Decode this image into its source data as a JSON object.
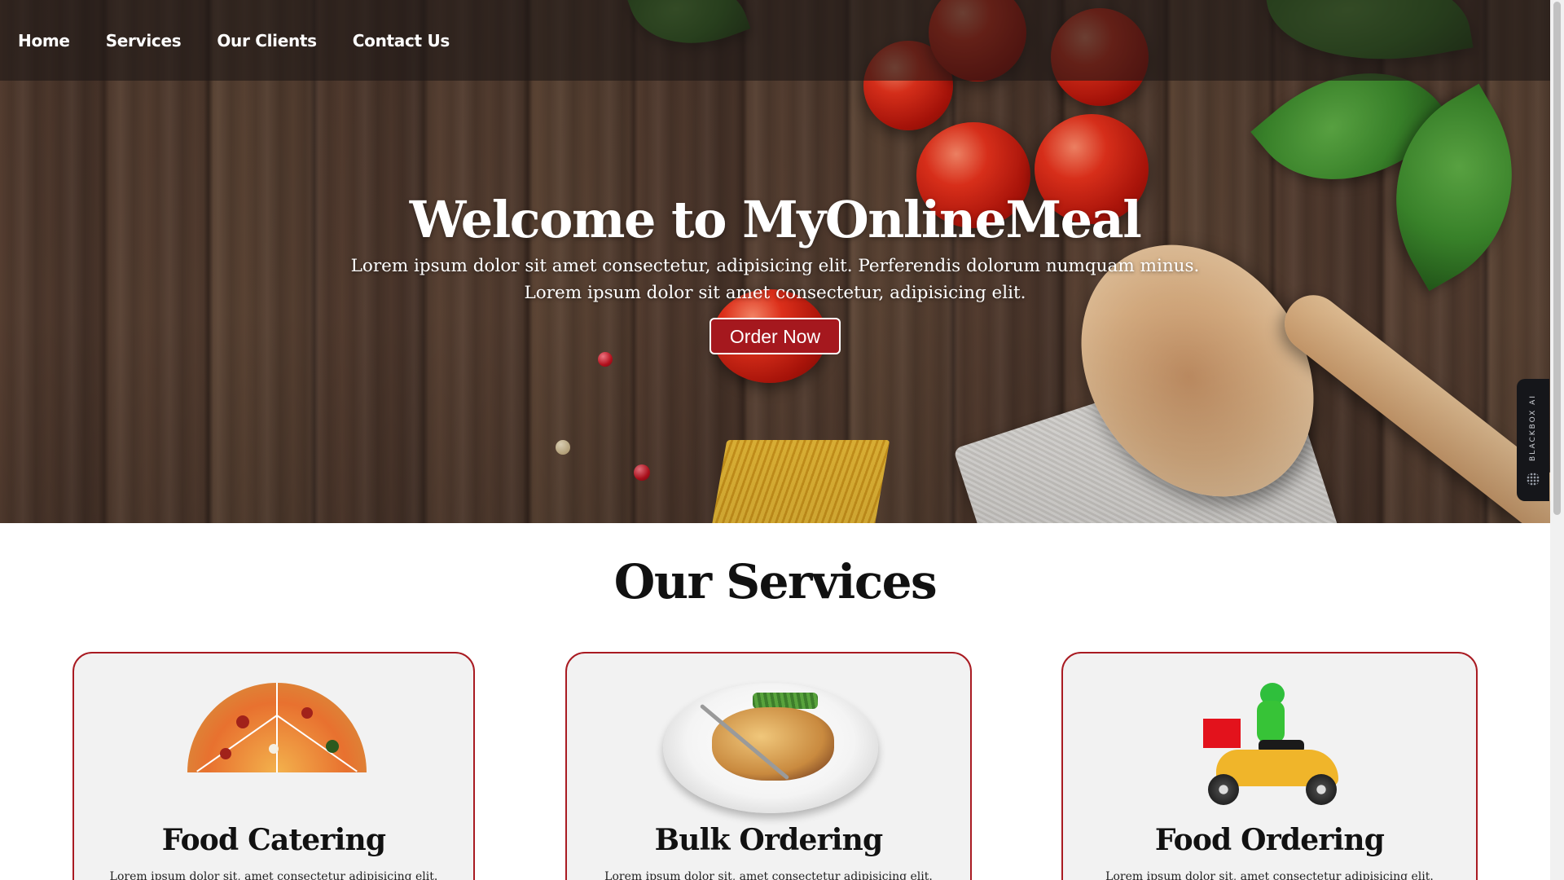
{
  "nav": {
    "items": [
      {
        "label": "Home"
      },
      {
        "label": "Services"
      },
      {
        "label": "Our Clients"
      },
      {
        "label": "Contact Us"
      }
    ]
  },
  "hero": {
    "title": "Welcome to MyOnlineMeal",
    "subtitle_line1": "Lorem ipsum dolor sit amet consectetur, adipisicing elit. Perferendis dolorum numquam minus.",
    "subtitle_line2": "Lorem ipsum dolor sit amet consectetur, adipisicing elit.",
    "cta_label": "Order Now"
  },
  "side_tab": {
    "label": "BLACKBOX AI"
  },
  "services": {
    "title": "Our Services",
    "cards": [
      {
        "title": "Food Catering",
        "text": "Lorem ipsum dolor sit, amet consectetur adipisicing elit.",
        "image": "pizza-image"
      },
      {
        "title": "Bulk Ordering",
        "text": "Lorem ipsum dolor sit, amet consectetur adipisicing elit.",
        "image": "plate-image"
      },
      {
        "title": "Food Ordering",
        "text": "Lorem ipsum dolor sit, amet consectetur adipisicing elit.",
        "image": "delivery-scooter-image"
      }
    ]
  },
  "colors": {
    "accent": "#a5181e",
    "card_border": "#a91b22",
    "card_bg": "#f2f2f2",
    "nav_bg": "rgba(30,24,22,0.62)"
  }
}
